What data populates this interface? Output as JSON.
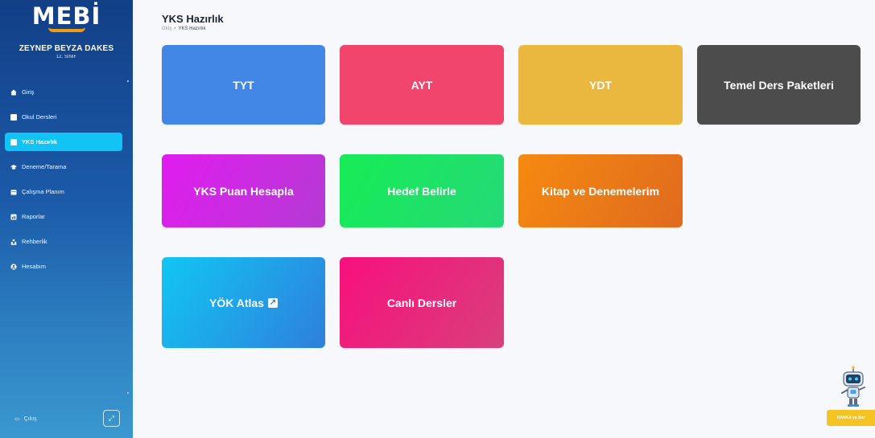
{
  "sidebar": {
    "logo": "MEBİ",
    "user_name": "ZEYNEP BEYZA DAKES",
    "user_class": "12. SINIF",
    "items": [
      {
        "label": "Giriş",
        "icon": "home-icon"
      },
      {
        "label": "Okul Dersleri",
        "icon": "book-icon"
      },
      {
        "label": "YKS Hazırlık",
        "icon": "book-icon",
        "active": true
      },
      {
        "label": "Deneme/Tarama",
        "icon": "graduation-cap-icon"
      },
      {
        "label": "Çalışma Planım",
        "icon": "calendar-icon"
      },
      {
        "label": "Raporlar",
        "icon": "report-icon"
      },
      {
        "label": "Rehberlik",
        "icon": "people-icon"
      },
      {
        "label": "Hesabım",
        "icon": "user-circle-icon"
      }
    ],
    "logout_label": "Çıkış"
  },
  "header": {
    "title": "YKS Hazırlık",
    "breadcrumb": [
      "Giriş",
      "YKS Hazırlık"
    ]
  },
  "tiles": [
    {
      "label": "TYT",
      "color": "#4387e6"
    },
    {
      "label": "AYT",
      "color": "#f2456d"
    },
    {
      "label": "YDT",
      "color": "#eab83e"
    },
    {
      "label": "Temel Ders Paketleri",
      "color": "#4c4c4c"
    },
    {
      "label": "YKS Puan Hesapla",
      "color": "#e11cf0"
    },
    {
      "label": "Hedef Belirle",
      "color": "#17ec55"
    },
    {
      "label": "Kitap ve Denemelerim",
      "color": "#f58a0f"
    },
    {
      "label": "YÖK Atlas",
      "color": "#11c6f4",
      "icon": "external-link-icon"
    },
    {
      "label": "Canlı Dersler",
      "color": "#f7107d"
    }
  ],
  "assistant": {
    "label": "RANKA ya Sor"
  },
  "colors": {
    "sidebar_active": "#12c4f5",
    "accent": "#f39c12"
  }
}
